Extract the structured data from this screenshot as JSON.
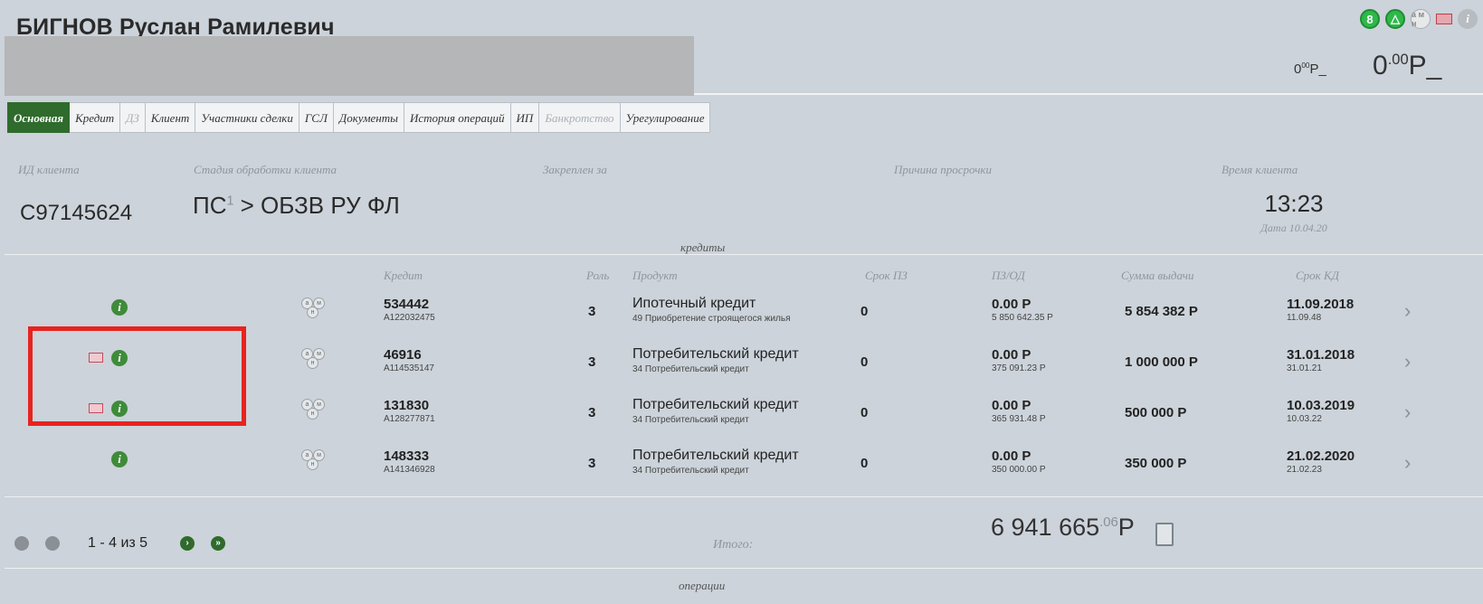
{
  "header": {
    "client_name": "БИГНОВ Руслан Рамилевич",
    "balance_small": "0",
    "balance_small_sup": "00",
    "balance_small_unit": "Р_",
    "balance_big": "0",
    "balance_big_sup": ".00",
    "balance_big_unit": "Р_",
    "status_icons": [
      "8",
      "△",
      "a м н",
      "flag",
      "i"
    ]
  },
  "tabs": [
    {
      "label": "Основная",
      "state": "active"
    },
    {
      "label": "Кредит",
      "state": "normal"
    },
    {
      "label": "ДЗ",
      "state": "disabled"
    },
    {
      "label": "Клиент",
      "state": "normal"
    },
    {
      "label": "Участники сделки",
      "state": "normal"
    },
    {
      "label": "ГСЛ",
      "state": "normal"
    },
    {
      "label": "Документы",
      "state": "normal"
    },
    {
      "label": "История операций",
      "state": "normal"
    },
    {
      "label": "ИП",
      "state": "normal"
    },
    {
      "label": "Банкротство",
      "state": "disabled"
    },
    {
      "label": "Урегулирование",
      "state": "normal"
    }
  ],
  "info": {
    "client_id_label": "ИД клиента",
    "client_id": "С97145624",
    "stage_label": "Стадия обработки клиента",
    "stage_prefix": "ПС",
    "stage_sup": "1",
    "stage_rest": " > ОБЗВ РУ ФЛ",
    "assigned_label": "Закреплен за",
    "overdue_reason_label": "Причина просрочки",
    "client_time_label": "Время клиента",
    "client_time": "13:23",
    "date": "Дата 10.04.20"
  },
  "credits": {
    "section_title": "кредиты",
    "columns": {
      "credit": "Кредит",
      "role": "Роль",
      "product": "Продукт",
      "term_pz": "Срок ПЗ",
      "pz_od": "ПЗ/ОД",
      "amount": "Сумма выдачи",
      "term_kd": "Срок КД"
    },
    "rows": [
      {
        "flag": false,
        "credit": "534442",
        "account": "А122032475",
        "role": "3",
        "product": "Ипотечный кредит",
        "product_sub": "49 Приобретение строящегося жилья",
        "term_pz": "0",
        "pz": "0.00 Р",
        "od": "5 850 642.35 Р",
        "amount": "5 854 382 Р",
        "term_kd": "11.09.2018",
        "term_kd_sub": "11.09.48"
      },
      {
        "flag": true,
        "credit": "46916",
        "account": "А114535147",
        "role": "3",
        "product": "Потребительский кредит",
        "product_sub": "34 Потребительский кредит",
        "term_pz": "0",
        "pz": "0.00 Р",
        "od": "375 091.23 Р",
        "amount": "1 000 000 Р",
        "term_kd": "31.01.2018",
        "term_kd_sub": "31.01.21"
      },
      {
        "flag": true,
        "credit": "131830",
        "account": "А128277871",
        "role": "3",
        "product": "Потребительский кредит",
        "product_sub": "34 Потребительский кредит",
        "term_pz": "0",
        "pz": "0.00 Р",
        "od": "365 931.48 Р",
        "amount": "500 000 Р",
        "term_kd": "10.03.2019",
        "term_kd_sub": "10.03.22"
      },
      {
        "flag": false,
        "credit": "148333",
        "account": "А141346928",
        "role": "3",
        "product": "Потребительский кредит",
        "product_sub": "34 Потребительский кредит",
        "term_pz": "0",
        "pz": "0.00 Р",
        "od": "350 000.00 Р",
        "amount": "350 000 Р",
        "term_kd": "21.02.2020",
        "term_kd_sub": "21.02.23"
      }
    ],
    "pager": "1 - 4 из 5",
    "total_label": "Итого:",
    "total_main": "6 941 665",
    "total_sup": ".06",
    "total_unit": "Р"
  },
  "operations": {
    "section_title": "операции"
  },
  "colors": {
    "accent_green": "#2f6b2c",
    "highlight_red": "#e8231f",
    "background": "#ccd3da"
  }
}
